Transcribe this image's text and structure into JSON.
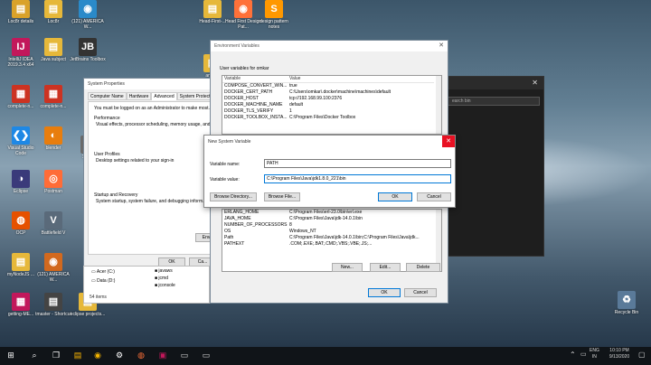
{
  "desktop": {
    "icons": [
      {
        "label": "Loc8r details",
        "glyph": "▤",
        "color": "#d9a22a"
      },
      {
        "label": "Loc8r",
        "glyph": "▤",
        "color": "#e6b83a"
      },
      {
        "label": "(121) AMERICA W...",
        "glyph": "◉",
        "color": "#2a8ac9"
      },
      {
        "label": "IntelliJ IDEA 2019.3.4 x64",
        "glyph": "IJ",
        "color": "#c2185b"
      },
      {
        "label": "Java subject",
        "glyph": "▤",
        "color": "#e6b83a"
      },
      {
        "label": "JetBrains Toolbox",
        "glyph": "JB",
        "color": "#333"
      },
      {
        "label": "complete-n...",
        "glyph": "▦",
        "color": "#cc3322"
      },
      {
        "label": "complete-n...",
        "glyph": "▦",
        "color": "#cc3322"
      },
      {
        "label": "Visual Studio Code",
        "glyph": "❮❯",
        "color": "#1e88e5"
      },
      {
        "label": "blender",
        "glyph": "◐",
        "color": "#e87d0d"
      },
      {
        "label": "Eclipse",
        "glyph": "◑",
        "color": "#3a3a7a"
      },
      {
        "label": "Postman",
        "glyph": "◎",
        "color": "#ff6c37"
      },
      {
        "label": "OCP",
        "glyph": "◍",
        "color": "#e65100"
      },
      {
        "label": "Battlefield V",
        "glyph": "V",
        "color": "#5a6a7a"
      },
      {
        "label": "myNodeJS ...",
        "glyph": "▤",
        "color": "#e6b83a"
      },
      {
        "label": "(121) AMERICA W...",
        "glyph": "◉",
        "color": "#d2691e"
      },
      {
        "label": "getting-ME...",
        "glyph": "▦",
        "color": "#c2185b"
      },
      {
        "label": "tmaster - Shortcut",
        "glyph": "▤",
        "color": "#444"
      },
      {
        "label": "eclipse projects...",
        "glyph": "▤",
        "color": "#e6b83a"
      },
      {
        "label": "Head-First-...",
        "glyph": "▤",
        "color": "#e6b83a"
      },
      {
        "label": "Head First Design Pat...",
        "glyph": "◉",
        "color": "#ff7139"
      },
      {
        "label": "design pattern notes",
        "glyph": "S",
        "color": "#ff9800"
      },
      {
        "label": "angu...",
        "glyph": "▤",
        "color": "#e6b83a"
      },
      {
        "label": "13.09...",
        "glyph": "▤",
        "color": "#6a6a6a"
      },
      {
        "label": "Recycle Bin",
        "glyph": "♻",
        "color": "#5a7a99"
      }
    ]
  },
  "system_properties": {
    "title": "System Properties",
    "tabs": [
      "Computer Name",
      "Hardware",
      "Advanced",
      "System Protection"
    ],
    "admin_note": "You must be logged on as an Administrator to make most...",
    "performance": {
      "title": "Performance",
      "desc": "Visual effects, processor scheduling, memory usage, and..."
    },
    "user_profiles": {
      "title": "User Profiles",
      "desc": "Desktop settings related to your sign-in"
    },
    "startup": {
      "title": "Startup and Recovery",
      "desc": "System startup, system failure, and debugging inform..."
    },
    "env_button": "Env...",
    "ok": "OK",
    "cancel": "Ca..."
  },
  "explorer": {
    "items": [
      "Acer (C:)",
      "Data (D:)"
    ],
    "files": [
      "javaws",
      "jcmd",
      "jconsole"
    ],
    "status": "54 items"
  },
  "env_dialog": {
    "title": "Environment Variables",
    "user_section": "User variables for omkar",
    "col_variable": "Variable",
    "col_value": "Value",
    "user_vars": [
      {
        "name": "COMPOSE_CONVERT_WIN...",
        "value": "true"
      },
      {
        "name": "DOCKER_CERT_PATH",
        "value": "C:\\Users\\omkar\\.docker\\machine\\machines\\default"
      },
      {
        "name": "DOCKER_HOST",
        "value": "tcp://192.168.99.100:2376"
      },
      {
        "name": "DOCKER_MACHINE_NAME",
        "value": "default"
      },
      {
        "name": "DOCKER_TLS_VERIFY",
        "value": "1"
      },
      {
        "name": "DOCKER_TOOLBOX_INSTA...",
        "value": "C:\\Program Files\\Docker Toolbox"
      }
    ],
    "system_vars": [
      {
        "name": "ERLANG_HOME",
        "value": "C:\\Program Files\\erl-23.0\\bin\\erl.exe"
      },
      {
        "name": "JAVA_HOME",
        "value": "C:\\Program Files\\Java\\jdk-14.0.1\\bin"
      },
      {
        "name": "NUMBER_OF_PROCESSORS",
        "value": "8"
      },
      {
        "name": "OS",
        "value": "Windows_NT"
      },
      {
        "name": "Path",
        "value": "C:\\Program Files\\Java\\jdk-14.0.1\\bin;C:\\Program Files\\Java\\jdk..."
      },
      {
        "name": "PATHEXT",
        "value": ".COM;.EXE;.BAT;.CMD;.VBS;.VBE;.JS;..."
      }
    ],
    "new": "New...",
    "edit": "Edit...",
    "delete": "Delete",
    "ok": "OK",
    "cancel": "Cancel"
  },
  "new_var_dialog": {
    "title": "New System Variable",
    "name_label": "Variable name:",
    "name_value": "PATH",
    "value_label": "Variable value:",
    "value_value": "C:\\Program Files\\Java\\jdk1.8.0_221\\bin",
    "browse_dir": "Browse Directory...",
    "browse_file": "Browse File...",
    "ok": "OK",
    "cancel": "Cancel"
  },
  "terminal": {
    "search_hint": "earch bin"
  },
  "taskbar": {
    "time": "10:10 PM",
    "date": "9/13/2020",
    "lang": "ENG",
    "region": "IN"
  }
}
